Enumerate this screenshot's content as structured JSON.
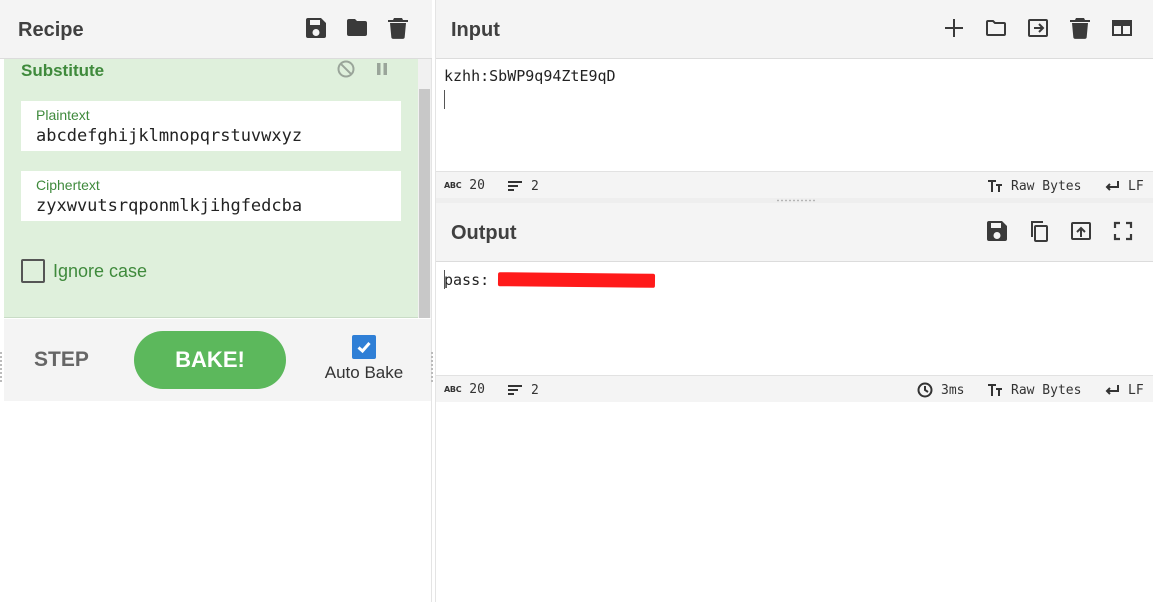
{
  "recipe": {
    "title": "Recipe",
    "operation": {
      "name": "Substitute",
      "fields": [
        {
          "label": "Plaintext",
          "value": "abcdefghijklmnopqrstuvwxyz"
        },
        {
          "label": "Ciphertext",
          "value": "zyxwvutsrqponmlkjihgfedcba"
        }
      ],
      "ignore_case_label": "Ignore case",
      "ignore_case_checked": false
    },
    "controls": {
      "step_label": "STEP",
      "bake_label": "BAKE!",
      "auto_bake_label": "Auto Bake",
      "auto_bake_checked": true
    },
    "header_icons": [
      "save-icon",
      "folder-icon",
      "trash-icon"
    ]
  },
  "input": {
    "title": "Input",
    "text": "kzhh:SbWP9q94ZtE9qD",
    "status": {
      "chars": "20",
      "lines": "2",
      "encoding": "Raw Bytes",
      "eol": "LF"
    },
    "header_icons": [
      "plus-icon",
      "folder-icon",
      "sign-in-icon",
      "trash-icon",
      "layout-icon"
    ]
  },
  "output": {
    "title": "Output",
    "text": "pass:",
    "status": {
      "chars": "20",
      "lines": "2",
      "time": "3ms",
      "encoding": "Raw Bytes",
      "eol": "LF"
    },
    "header_icons": [
      "save-icon",
      "copy-icon",
      "replace-input-icon",
      "fullscreen-icon"
    ]
  },
  "colors": {
    "operation_bg": "#dff0dc",
    "operation_accent": "#3f8a3c",
    "bake_button": "#5cb85c",
    "checkbox_checked": "#2f7fd6",
    "redaction": "#ff1a1a"
  }
}
